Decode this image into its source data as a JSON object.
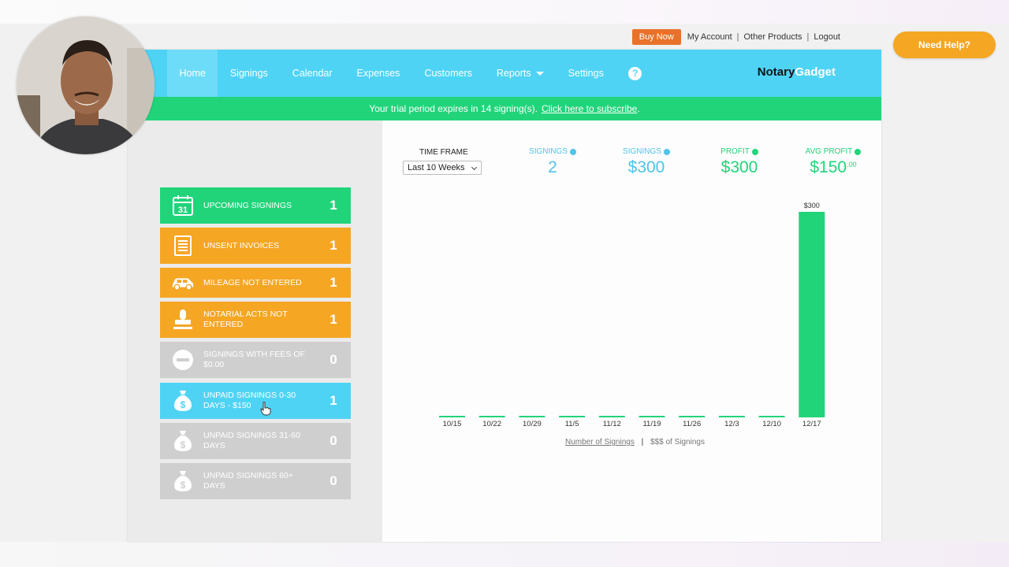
{
  "account": {
    "buy_now": "Buy Now",
    "my_account": "My Account",
    "other_products": "Other Products",
    "logout": "Logout",
    "separator": "|"
  },
  "need_help": "Need Help?",
  "nav": {
    "items": [
      "Home",
      "Signings",
      "Calendar",
      "Expenses",
      "Customers",
      "Reports",
      "Settings"
    ],
    "help": "?",
    "logo_a": "Notary",
    "logo_b": "Gadget"
  },
  "trial": {
    "text": "Your trial period expires in 14 signing(s).",
    "link": "Click here to subscribe",
    "period": "."
  },
  "tiles": [
    {
      "label": "UPCOMING SIGNINGS",
      "count": "1",
      "icon": "calendar-icon",
      "icon_text": "31",
      "color": "#21d47a"
    },
    {
      "label": "UNSENT INVOICES",
      "count": "1",
      "icon": "invoice-icon",
      "color": "#f5a623"
    },
    {
      "label": "MILEAGE NOT ENTERED",
      "count": "1",
      "icon": "car-icon",
      "color": "#f5a623"
    },
    {
      "label": "NOTARIAL ACTS NOT ENTERED",
      "count": "1",
      "icon": "stamp-icon",
      "color": "#f5a623"
    },
    {
      "label": "SIGNINGS WITH FEES OF $0.00",
      "count": "0",
      "icon": "minus-circle-icon",
      "color": "#cfcfcf"
    },
    {
      "label": "UNPAID SIGNINGS 0-30 DAYS - $150",
      "count": "1",
      "icon": "money-bag-icon",
      "color": "#4fd3f5"
    },
    {
      "label": "UNPAID SIGNINGS 31-60 DAYS",
      "count": "0",
      "icon": "money-bag-icon",
      "color": "#cfcfcf"
    },
    {
      "label": "UNPAID SIGNINGS 60+ DAYS",
      "count": "0",
      "icon": "money-bag-icon",
      "color": "#cfcfcf"
    }
  ],
  "timeframe": {
    "label": "TIME FRAME",
    "selected": "Last 10 Weeks"
  },
  "stats": [
    {
      "label": "SIGNINGS",
      "value": "2"
    },
    {
      "label": "SIGNINGS",
      "value": "$300"
    },
    {
      "label": "PROFIT",
      "value": "$300"
    },
    {
      "label": "AVG PROFIT",
      "value": "$150",
      "cents": ".00"
    }
  ],
  "chart_links": {
    "number": "Number of Signings",
    "sep": "|",
    "dollars": "$$$ of Signings"
  },
  "chart_data": {
    "type": "bar",
    "categories": [
      "10/15",
      "10/22",
      "10/29",
      "11/5",
      "11/12",
      "11/19",
      "11/26",
      "12/3",
      "12/10",
      "12/17"
    ],
    "values": [
      0,
      0,
      0,
      0,
      0,
      0,
      0,
      0,
      0,
      300
    ],
    "value_labels": [
      "",
      "",
      "",
      "",
      "",
      "",
      "",
      "",
      "",
      "$300"
    ],
    "ylim": [
      0,
      300
    ],
    "color": "#21d47a"
  }
}
